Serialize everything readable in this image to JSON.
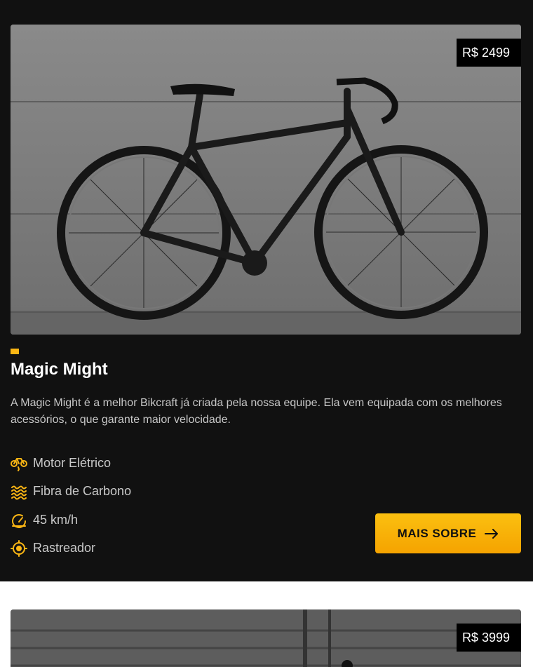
{
  "products": [
    {
      "price": "R$ 2499",
      "name": "Magic Might",
      "description": "A Magic Might é a melhor Bikcraft já criada pela nossa equipe. Ela vem equipada com os melhores acessórios, o que garante maior velocidade.",
      "features": [
        {
          "label": "Motor Elétrico",
          "icon": "electric-bike-icon"
        },
        {
          "label": "Fibra de Carbono",
          "icon": "carbon-fiber-icon"
        },
        {
          "label": "45 km/h",
          "icon": "speedometer-icon"
        },
        {
          "label": "Rastreador",
          "icon": "tracker-icon"
        }
      ],
      "button_label": "MAIS SOBRE",
      "button_icon": "arrow-right-icon"
    },
    {
      "price": "R$ 3999"
    }
  ],
  "colors": {
    "accent": "#fbb614",
    "background": "#111111",
    "text_light": "#ffffff",
    "text_muted": "#c7c7c7"
  }
}
